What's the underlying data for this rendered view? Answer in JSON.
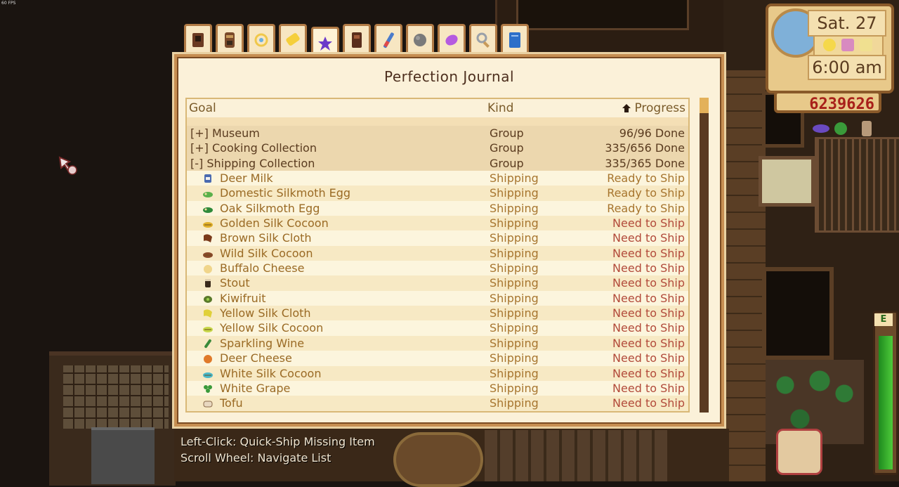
{
  "fps_label": "60 FPS",
  "hud": {
    "date": "Sat. 27",
    "time": "6:00 am",
    "money": "6239626",
    "energy_label": "E"
  },
  "tabs": [
    {
      "name": "tab-tv",
      "icon": "tv-icon",
      "color": "#6b3a22"
    },
    {
      "name": "tab-totem",
      "icon": "totem-icon",
      "color": "#7a4a2a"
    },
    {
      "name": "tab-ring",
      "icon": "ring-icon",
      "color": "#f0c84a"
    },
    {
      "name": "tab-ticket",
      "icon": "ticket-icon",
      "color": "#f5cf3a"
    },
    {
      "name": "tab-perfection",
      "icon": "stardrop-icon",
      "color": "#6b3ac9"
    },
    {
      "name": "tab-cabinet",
      "icon": "cabinet-icon",
      "color": "#5a2e1c"
    },
    {
      "name": "tab-wand",
      "icon": "wand-icon",
      "color": "#4a7acb"
    },
    {
      "name": "tab-geode",
      "icon": "geode-icon",
      "color": "#7a7a7a"
    },
    {
      "name": "tab-gem",
      "icon": "gem-icon",
      "color": "#b55ae0"
    },
    {
      "name": "tab-search",
      "icon": "magnifier-icon",
      "color": "#9aa0a8"
    },
    {
      "name": "tab-book",
      "icon": "book-icon",
      "color": "#2d6fc9"
    }
  ],
  "journal": {
    "title": "Perfection Journal",
    "columns": {
      "goal": "Goal",
      "kind": "Kind",
      "progress": "Progress"
    },
    "rows": [
      {
        "type": "group",
        "goal": "[+] Museum",
        "kind": "Group",
        "progress": "96/96 Done"
      },
      {
        "type": "group",
        "goal": "[+] Cooking Collection",
        "kind": "Group",
        "progress": "335/656 Done"
      },
      {
        "type": "group",
        "goal": "[-] Shipping Collection",
        "kind": "Group",
        "progress": "335/365 Done"
      },
      {
        "type": "item",
        "goal": "Deer Milk",
        "kind": "Shipping",
        "progress": "Ready to Ship",
        "status": "ready",
        "icon": "milk-icon",
        "color": "#4a6ab0"
      },
      {
        "type": "item",
        "goal": "Domestic Silkmoth Egg",
        "kind": "Shipping",
        "progress": "Ready to Ship",
        "status": "ready",
        "icon": "egg-icon",
        "color": "#5ab04a"
      },
      {
        "type": "item",
        "goal": "Oak Silkmoth Egg",
        "kind": "Shipping",
        "progress": "Ready to Ship",
        "status": "ready",
        "icon": "egg-icon",
        "color": "#2f8a3a"
      },
      {
        "type": "item",
        "goal": "Golden Silk Cocoon",
        "kind": "Shipping",
        "progress": "Need to Ship",
        "status": "need",
        "icon": "cocoon-icon",
        "color": "#e0b02a"
      },
      {
        "type": "item",
        "goal": "Brown Silk Cloth",
        "kind": "Shipping",
        "progress": "Need to Ship",
        "status": "need",
        "icon": "cloth-icon",
        "color": "#7a3a1a"
      },
      {
        "type": "item",
        "goal": "Wild Silk Cocoon",
        "kind": "Shipping",
        "progress": "Need to Ship",
        "status": "need",
        "icon": "cocoon-icon",
        "color": "#8a4a2a"
      },
      {
        "type": "item",
        "goal": "Buffalo Cheese",
        "kind": "Shipping",
        "progress": "Need to Ship",
        "status": "need",
        "icon": "cheese-icon",
        "color": "#f0d58a"
      },
      {
        "type": "item",
        "goal": "Stout",
        "kind": "Shipping",
        "progress": "Need to Ship",
        "status": "need",
        "icon": "mug-icon",
        "color": "#3a2a1a"
      },
      {
        "type": "item",
        "goal": "Kiwifruit",
        "kind": "Shipping",
        "progress": "Need to Ship",
        "status": "need",
        "icon": "kiwi-icon",
        "color": "#5a7a2a"
      },
      {
        "type": "item",
        "goal": "Yellow Silk Cloth",
        "kind": "Shipping",
        "progress": "Need to Ship",
        "status": "need",
        "icon": "cloth-icon",
        "color": "#e0d03a"
      },
      {
        "type": "item",
        "goal": "Yellow Silk Cocoon",
        "kind": "Shipping",
        "progress": "Need to Ship",
        "status": "need",
        "icon": "cocoon-icon",
        "color": "#c8d84a"
      },
      {
        "type": "item",
        "goal": "Sparkling Wine",
        "kind": "Shipping",
        "progress": "Need to Ship",
        "status": "need",
        "icon": "bottle-icon",
        "color": "#3a8a3a"
      },
      {
        "type": "item",
        "goal": "Deer Cheese",
        "kind": "Shipping",
        "progress": "Need to Ship",
        "status": "need",
        "icon": "cheese-icon",
        "color": "#e07a2a"
      },
      {
        "type": "item",
        "goal": "White Silk Cocoon",
        "kind": "Shipping",
        "progress": "Need to Ship",
        "status": "need",
        "icon": "cocoon-icon",
        "color": "#4ab8c8"
      },
      {
        "type": "item",
        "goal": "White Grape",
        "kind": "Shipping",
        "progress": "Need to Ship",
        "status": "need",
        "icon": "grape-icon",
        "color": "#3a9a3a"
      },
      {
        "type": "item",
        "goal": "Tofu",
        "kind": "Shipping",
        "progress": "Need to Ship",
        "status": "need",
        "icon": "tofu-icon",
        "color": "#e8d8c0"
      }
    ]
  },
  "hints": [
    "Left-Click: Quick-Ship Missing Item",
    "Scroll Wheel: Navigate List"
  ]
}
